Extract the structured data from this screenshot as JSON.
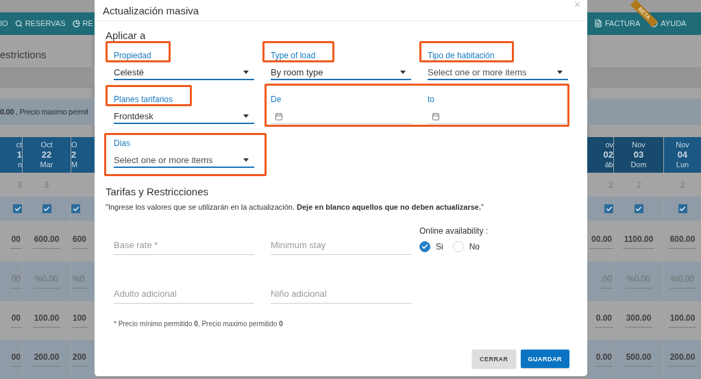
{
  "background": {
    "nav_left": [
      {
        "label": "IO",
        "kind": "plain"
      },
      {
        "label": "RESERVAS",
        "kind": "search"
      },
      {
        "label": "RE",
        "kind": "chart"
      }
    ],
    "nav_right": [
      {
        "label": "FACTURA",
        "kind": "document"
      },
      {
        "label": "AYUDA",
        "kind": "help"
      }
    ],
    "beta_ribbon": "BETA",
    "page_title": "estrictions",
    "notice": "**0.00** , Precio maximo permit",
    "columns_left": [
      {
        "month": "ct",
        "day": "1",
        "weekday": "n",
        "weekend": false,
        "count": "3",
        "checked": true,
        "values": [
          {
            "text": "00",
            "kind": "price"
          },
          {
            "text": "00",
            "kind": "percent"
          },
          {
            "text": "00",
            "kind": "price"
          },
          {
            "text": "00",
            "kind": "price"
          }
        ]
      },
      {
        "month": "Oct",
        "day": "22",
        "weekday": "Mar",
        "weekend": false,
        "count": "3",
        "checked": true,
        "values": [
          {
            "text": "600.00",
            "kind": "price"
          },
          {
            "text": "%0.00",
            "kind": "percent"
          },
          {
            "text": "100.00",
            "kind": "price"
          },
          {
            "text": "200.00",
            "kind": "price"
          }
        ]
      },
      {
        "month": "O",
        "day": "2",
        "weekday": "M",
        "weekend": false,
        "checked": true,
        "values": [
          {
            "text": "600",
            "kind": "price"
          },
          {
            "text": "%0.",
            "kind": "percent"
          },
          {
            "text": "100",
            "kind": "price"
          },
          {
            "text": "200",
            "kind": "price"
          }
        ]
      }
    ],
    "columns_right": [
      {
        "month": "ov",
        "day": "02",
        "weekday": "áb",
        "weekend": true,
        "count": "2",
        "checked": true,
        "values": [
          {
            "text": "00.00",
            "kind": "price"
          },
          {
            "text": ".00",
            "kind": "percent"
          },
          {
            "text": "0.00",
            "kind": "price"
          },
          {
            "text": "0.00",
            "kind": "price"
          }
        ]
      },
      {
        "month": "Nov",
        "day": "03",
        "weekday": "Dom",
        "weekend": true,
        "count": "2",
        "checked": true,
        "values": [
          {
            "text": "1100.00",
            "kind": "price"
          },
          {
            "text": "%0.00",
            "kind": "percent"
          },
          {
            "text": "300.00",
            "kind": "price"
          },
          {
            "text": "500.00",
            "kind": "price"
          }
        ]
      },
      {
        "month": "Nov",
        "day": "04",
        "weekday": "Lun",
        "weekend": false,
        "count": "2",
        "checked": true,
        "values": [
          {
            "text": "600.00",
            "kind": "price"
          },
          {
            "text": "%0.00",
            "kind": "percent"
          },
          {
            "text": "100.00",
            "kind": "price"
          },
          {
            "text": "200.00",
            "kind": "price"
          }
        ]
      }
    ]
  },
  "dialog": {
    "title": "Actualización masiva",
    "close": "×",
    "apply_heading": "Aplicar a",
    "filter_rows": [
      [
        {
          "kind": "select",
          "label": "Propiedad",
          "value": "Celesté",
          "label_highlighted": true,
          "field_highlighted": false
        },
        {
          "kind": "select",
          "label": "Type of load",
          "value": "By room type",
          "label_highlighted": true,
          "field_highlighted": false
        },
        {
          "kind": "select",
          "label": "Tipo de habitación",
          "placeholder": "Select one or more items",
          "label_highlighted": true,
          "field_highlighted": false
        }
      ],
      [
        {
          "kind": "select",
          "label": "Planes tarifarios",
          "value": "Frontdesk",
          "label_highlighted": true,
          "field_highlighted": false
        },
        {
          "kind": "date_range",
          "highlighted": true,
          "fields": [
            {
              "label": "De"
            },
            {
              "label": "to"
            }
          ]
        }
      ],
      [
        {
          "kind": "select",
          "label": "Dias",
          "placeholder": "Select one or more items",
          "label_highlighted": false,
          "field_highlighted": true
        }
      ]
    ],
    "rates_heading": "Tarifas y Restricciones",
    "rates_note": "\"Ingrese los valores que se utilizarán en la actualización. **Deje en blanco aquellos que no deben actualizarse.**\"",
    "inputs": [
      {
        "placeholder": "Base rate *"
      },
      {
        "placeholder": "Minimum stay"
      },
      {
        "placeholder": "Adulto adicional"
      },
      {
        "placeholder": "Niño adicional"
      }
    ],
    "online_availability": {
      "label": "Online availability :",
      "options": [
        {
          "label": "Si",
          "selected": true
        },
        {
          "label": "No",
          "selected": false
        }
      ]
    },
    "footnote": "* Precio mínimo permitido **0**, Precio maximo permitido **0**",
    "buttons": [
      {
        "label": "CERRAR",
        "kind": "secondary"
      },
      {
        "label": "GUARDAR",
        "kind": "primary"
      }
    ]
  }
}
